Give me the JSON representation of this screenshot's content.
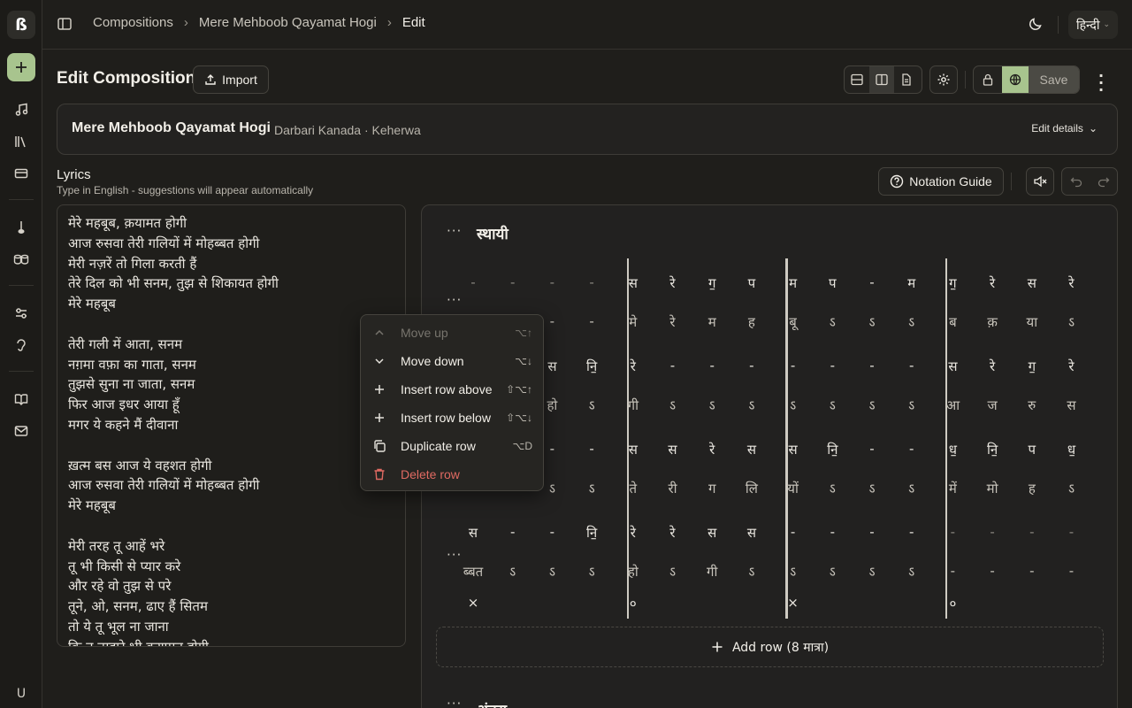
{
  "app": {
    "logo": "ß"
  },
  "rail": {
    "items": [
      "new-icon",
      "music-note-icon",
      "library-icon",
      "card-icon",
      "tanpura-icon",
      "tabla-icon",
      "sliders-icon",
      "ear-icon",
      "book-icon",
      "mail-icon"
    ],
    "avatar": "U",
    "accent": "#a8c48e"
  },
  "topbar": {
    "breadcrumbs": [
      "Compositions",
      "Mere Mehboob Qayamat Hogi",
      "Edit"
    ],
    "lang": "हिन्दी"
  },
  "header": {
    "title": "Edit Composition",
    "import_label": "Import",
    "save_label": "Save",
    "active_view": "split"
  },
  "meta": {
    "title": "Mere Mehboob Qayamat Hogi",
    "subtitle": "Darbari Kanada · Keherwa",
    "edit_label": "Edit details"
  },
  "lyrics": {
    "heading": "Lyrics",
    "hint": "Type in English - suggestions will appear automatically",
    "lines": [
      "मेरे महबूब, क़यामत होगी",
      "आज रुसवा तेरी गलियों में मोहब्बत होगी",
      "मेरी नज़रें तो गिला करती हैं",
      "तेरे दिल को भी सनम, तुझ से शिकायत होगी",
      "मेरे महबूब",
      "",
      "तेरी गली में आता, सनम",
      "नग़मा वफ़ा का गाता, सनम",
      "तुझसे सुना ना जाता, सनम",
      "फिर आज इधर आया हूँ",
      "मगर ये कहने मैं दीवाना",
      "",
      "ख़त्म बस आज ये वहशत होगी",
      "आज रुसवा तेरी गलियों में मोहब्बत होगी",
      "मेरे महबूब",
      "",
      "मेरी तरह तू आहें भरे",
      "तू भी किसी से प्यार करे",
      "और रहे वो तुझ से परे",
      "तूने, ओ, सनम, ढाए हैं सितम",
      "तो ये तू भूल ना जाना",
      "कि न तुम्हारे भी क़यामत होगी"
    ]
  },
  "toolbar": {
    "guide_label": "Notation Guide"
  },
  "notation": {
    "section": "स्थायी",
    "section2": "अंतरा",
    "add_row_label": "Add row (8 मात्रा)",
    "rows": [
      {
        "swar": [
          "-",
          "-",
          "-",
          "-",
          "स",
          "रे",
          "ग॒",
          "प",
          "म",
          "प",
          "-",
          "म",
          "ग॒",
          "रे",
          "स",
          "रे"
        ],
        "bol": [
          "-",
          "-",
          "-",
          "-",
          "मे",
          "रे",
          "म",
          "ह",
          "बू",
          "ऽ",
          "ऽ",
          "ऽ",
          "ब",
          "क़",
          "या",
          "ऽ"
        ]
      },
      {
        "swar": [
          "",
          "",
          "स",
          "नि॒",
          "रे",
          "-",
          "-",
          "-",
          "-",
          "-",
          "-",
          "-",
          "स",
          "रे",
          "ग॒",
          "रे"
        ],
        "bol": [
          "",
          "",
          "हो",
          "ऽ",
          "गी",
          "ऽ",
          "ऽ",
          "ऽ",
          "ऽ",
          "ऽ",
          "ऽ",
          "ऽ",
          "आ",
          "ज",
          "रु",
          "स"
        ]
      },
      {
        "swar": [
          "",
          "",
          "-",
          "-",
          "स",
          "स",
          "रे",
          "स",
          "स",
          "नि॒",
          "-",
          "-",
          "ध॒",
          "नि॒",
          "प",
          "ध॒"
        ],
        "bol": [
          "",
          "",
          "ऽ",
          "ऽ",
          "ते",
          "री",
          "ग",
          "लि",
          "यों",
          "ऽ",
          "ऽ",
          "ऽ",
          "में",
          "मो",
          "ह",
          "ऽ"
        ]
      },
      {
        "swar": [
          "स",
          "-",
          "-",
          "नि॒",
          "रे",
          "रे",
          "स",
          "स",
          "-",
          "-",
          "-",
          "-",
          "-",
          "-",
          "-",
          "-"
        ],
        "bol": [
          "ब्बत",
          "ऽ",
          "ऽ",
          "ऽ",
          "हो",
          "ऽ",
          "गी",
          "ऽ",
          "ऽ",
          "ऽ",
          "ऽ",
          "ऽ",
          "-",
          "-",
          "-",
          "-"
        ]
      }
    ],
    "tala": [
      "×",
      "०",
      "×",
      "०"
    ]
  },
  "context_menu": {
    "items": [
      {
        "label": "Move up",
        "shortcut": "⌥↑",
        "icon": "chevron-up-icon",
        "disabled": true
      },
      {
        "label": "Move down",
        "shortcut": "⌥↓",
        "icon": "chevron-down-icon"
      },
      {
        "label": "Insert row above",
        "shortcut": "⇧⌥↑",
        "icon": "plus-icon"
      },
      {
        "label": "Insert row below",
        "shortcut": "⇧⌥↓",
        "icon": "plus-icon"
      },
      {
        "label": "Duplicate row",
        "shortcut": "⌥D",
        "icon": "copy-icon"
      },
      {
        "label": "Delete row",
        "shortcut": "",
        "icon": "trash-icon",
        "danger": true
      }
    ]
  }
}
